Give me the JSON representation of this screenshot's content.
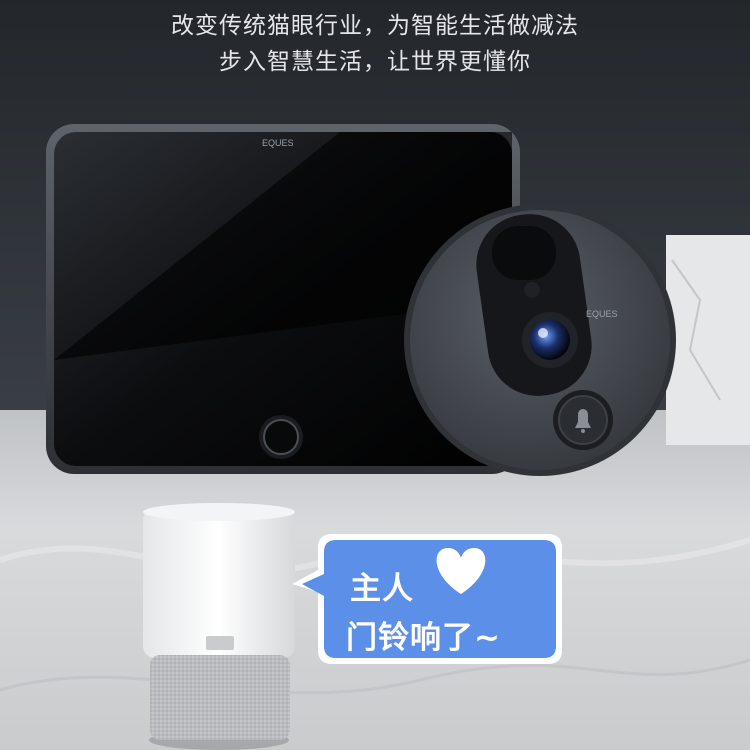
{
  "slogan": {
    "line1": "改变传统猫眼行业，为智能生活做减法",
    "line2": "步入智慧生活，让世界更懂你"
  },
  "brand": {
    "monitor_logo": "EQUES",
    "camera_logo": "EQUES"
  },
  "speech_bubble": {
    "line1": "主人",
    "line2": "门铃响了~"
  },
  "colors": {
    "background_top": "#23272c",
    "floor": "#d8dadc",
    "bubble_fill": "#5b8fe8",
    "bubble_border": "#ffffff",
    "camera_body": "#4a4e55",
    "monitor_screen": "#050607"
  },
  "icons": [
    "heart-icon",
    "bell-icon",
    "fingerprint-button-icon"
  ]
}
